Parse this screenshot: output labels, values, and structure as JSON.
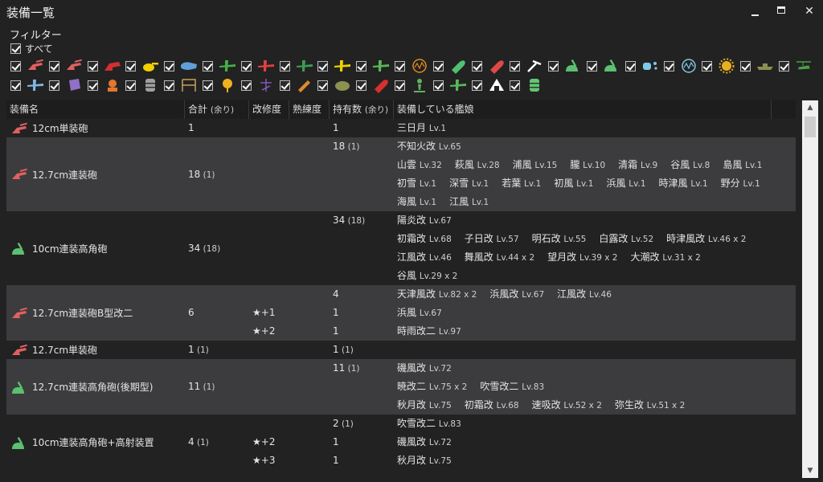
{
  "window": {
    "title": "装備一覧",
    "minimize": "_",
    "maximize": "□",
    "close": "✕"
  },
  "filter": {
    "label": "フィルター",
    "all_label": "すべて",
    "row1": [
      {
        "icon": "small-gun-icon",
        "color": "#e06060"
      },
      {
        "icon": "medium-gun-icon",
        "color": "#e06060"
      },
      {
        "icon": "large-gun-icon",
        "color": "#d03030"
      },
      {
        "icon": "secondary-gun-icon",
        "color": "#f0d000"
      },
      {
        "icon": "torpedo-icon",
        "color": "#5fa0d8"
      },
      {
        "icon": "fighter-icon",
        "color": "#46b046"
      },
      {
        "icon": "dive-bomber-icon",
        "color": "#e04040"
      },
      {
        "icon": "torpedo-bomber-icon",
        "color": "#3c9c52"
      },
      {
        "icon": "recon-plane-icon",
        "color": "#f0d000"
      },
      {
        "icon": "seaplane-icon",
        "color": "#58b858"
      },
      {
        "icon": "radar-icon",
        "color": "#e08a20"
      },
      {
        "icon": "aa-shell-icon",
        "color": "#50c070"
      },
      {
        "icon": "ap-shell-icon",
        "color": "#e04848"
      },
      {
        "icon": "damecon-icon",
        "color": "#ffffff"
      },
      {
        "icon": "aa-gun-icon",
        "color": "#5cc070"
      },
      {
        "icon": "high-angle-gun-icon",
        "color": "#5cc070"
      },
      {
        "icon": "depth-charge-icon",
        "color": "#80c8e8"
      },
      {
        "icon": "sonar-icon",
        "color": "#80c8e8"
      },
      {
        "icon": "engine-icon",
        "color": "#e8b020"
      },
      {
        "icon": "landing-craft-icon",
        "color": "#8c9050"
      },
      {
        "icon": "autogyro-icon",
        "color": "#4aa04a"
      }
    ],
    "row2": [
      {
        "icon": "asw-patrol-icon",
        "color": "#7cb8e0"
      },
      {
        "icon": "extra-armor-icon",
        "color": "#9070c8"
      },
      {
        "icon": "searchlight-icon",
        "color": "#e07830"
      },
      {
        "icon": "drum-canister-icon",
        "color": "#a0a0a0"
      },
      {
        "icon": "repair-facility-icon",
        "color": "#c8a060"
      },
      {
        "icon": "star-shell-icon",
        "color": "#f0b020"
      },
      {
        "icon": "command-facility-icon",
        "color": "#9060c8"
      },
      {
        "icon": "aviation-personnel-icon",
        "color": "#e08a30"
      },
      {
        "icon": "aa-director-icon",
        "color": "#8c9050"
      },
      {
        "icon": "rocket-icon",
        "color": "#d83030"
      },
      {
        "icon": "lookout-icon",
        "color": "#60b060"
      },
      {
        "icon": "flying-boat-icon",
        "color": "#58b858"
      },
      {
        "icon": "ration-icon",
        "color": "#ffffff"
      },
      {
        "icon": "supply-icon",
        "color": "#60c870"
      }
    ]
  },
  "table": {
    "headers": {
      "name": "装備名",
      "total": "合計",
      "total_sub": "(余り)",
      "improve": "改修度",
      "skill": "熟練度",
      "owned": "持有数",
      "owned_sub": "(余り)",
      "ships": "装備している艦娘"
    },
    "rows": [
      {
        "name": "12cm単装砲",
        "icon": "small-gun-icon",
        "total": "1",
        "total_rem": "",
        "groups": [
          {
            "star": "",
            "count": "1",
            "count_rem": "",
            "lines": [
              [
                [
                  "三日月",
                  "Lv.1"
                ]
              ]
            ]
          }
        ]
      },
      {
        "name": "12.7cm連装砲",
        "icon": "small-gun-icon",
        "total": "18",
        "total_rem": "(1)",
        "groups": [
          {
            "star": "",
            "count": "18",
            "count_rem": "(1)",
            "lines": [
              [
                [
                  "不知火改",
                  "Lv.65"
                ]
              ],
              [
                [
                  "山雲",
                  "Lv.32"
                ],
                [
                  "萩風",
                  "Lv.28"
                ],
                [
                  "浦風",
                  "Lv.15"
                ],
                [
                  "朧",
                  "Lv.10"
                ],
                [
                  "清霜",
                  "Lv.9"
                ],
                [
                  "谷風",
                  "Lv.8"
                ],
                [
                  "島風",
                  "Lv.1"
                ]
              ],
              [
                [
                  "初雪",
                  "Lv.1"
                ],
                [
                  "深雪",
                  "Lv.1"
                ],
                [
                  "若葉",
                  "Lv.1"
                ],
                [
                  "初風",
                  "Lv.1"
                ],
                [
                  "浜風",
                  "Lv.1"
                ],
                [
                  "時津風",
                  "Lv.1"
                ],
                [
                  "野分",
                  "Lv.1"
                ]
              ],
              [
                [
                  "海風",
                  "Lv.1"
                ],
                [
                  "江風",
                  "Lv.1"
                ]
              ]
            ]
          }
        ]
      },
      {
        "name": "10cm連装高角砲",
        "icon": "high-angle-gun-icon",
        "total": "34",
        "total_rem": "(18)",
        "groups": [
          {
            "star": "",
            "count": "34",
            "count_rem": "(18)",
            "lines": [
              [
                [
                  "陽炎改",
                  "Lv.67"
                ]
              ],
              [
                [
                  "初霜改",
                  "Lv.68"
                ],
                [
                  "子日改",
                  "Lv.57"
                ],
                [
                  "明石改",
                  "Lv.55"
                ],
                [
                  "白露改",
                  "Lv.52"
                ],
                [
                  "時津風改",
                  "Lv.46 x 2"
                ]
              ],
              [
                [
                  "江風改",
                  "Lv.46"
                ],
                [
                  "舞風改",
                  "Lv.44 x 2"
                ],
                [
                  "望月改",
                  "Lv.39 x 2"
                ],
                [
                  "大潮改",
                  "Lv.31 x 2"
                ]
              ],
              [
                [
                  "谷風",
                  "Lv.29 x 2"
                ]
              ]
            ]
          }
        ]
      },
      {
        "name": "12.7cm連装砲B型改二",
        "icon": "small-gun-icon",
        "total": "6",
        "total_rem": "",
        "groups": [
          {
            "star": "",
            "count": "4",
            "count_rem": "",
            "lines": [
              [
                [
                  "天津風改",
                  "Lv.82 x 2"
                ],
                [
                  "浜風改",
                  "Lv.67"
                ],
                [
                  "江風改",
                  "Lv.46"
                ]
              ]
            ]
          },
          {
            "star": "★+1",
            "count": "1",
            "count_rem": "",
            "lines": [
              [
                [
                  "浜風",
                  "Lv.67"
                ]
              ]
            ]
          },
          {
            "star": "★+2",
            "count": "1",
            "count_rem": "",
            "lines": [
              [
                [
                  "時雨改二",
                  "Lv.97"
                ]
              ]
            ]
          }
        ]
      },
      {
        "name": "12.7cm単装砲",
        "icon": "small-gun-icon",
        "total": "1",
        "total_rem": "(1)",
        "groups": [
          {
            "star": "",
            "count": "1",
            "count_rem": "(1)",
            "lines": []
          }
        ]
      },
      {
        "name": "12.7cm連装高角砲(後期型)",
        "icon": "high-angle-gun-icon",
        "total": "11",
        "total_rem": "(1)",
        "groups": [
          {
            "star": "",
            "count": "11",
            "count_rem": "(1)",
            "lines": [
              [
                [
                  "磯風改",
                  "Lv.72"
                ]
              ],
              [
                [
                  "暁改二",
                  "Lv.75 x 2"
                ],
                [
                  "吹雪改二",
                  "Lv.83"
                ]
              ],
              [
                [
                  "秋月改",
                  "Lv.75"
                ],
                [
                  "初霜改",
                  "Lv.68"
                ],
                [
                  "速吸改",
                  "Lv.52 x 2"
                ],
                [
                  "弥生改",
                  "Lv.51 x 2"
                ]
              ]
            ]
          }
        ]
      },
      {
        "name": "10cm連装高角砲+高射装置",
        "icon": "high-angle-gun-icon",
        "total": "4",
        "total_rem": "(1)",
        "groups": [
          {
            "star": "",
            "count": "2",
            "count_rem": "(1)",
            "lines": [
              [
                [
                  "吹雪改二",
                  "Lv.83"
                ]
              ]
            ]
          },
          {
            "star": "★+2",
            "count": "1",
            "count_rem": "",
            "lines": [
              [
                [
                  "磯風改",
                  "Lv.72"
                ]
              ]
            ]
          },
          {
            "star": "★+3",
            "count": "1",
            "count_rem": "",
            "lines": [
              [
                [
                  "秋月改",
                  "Lv.75"
                ]
              ]
            ]
          }
        ]
      }
    ]
  },
  "scrollbar": {
    "up": "▲",
    "down": "▼"
  }
}
